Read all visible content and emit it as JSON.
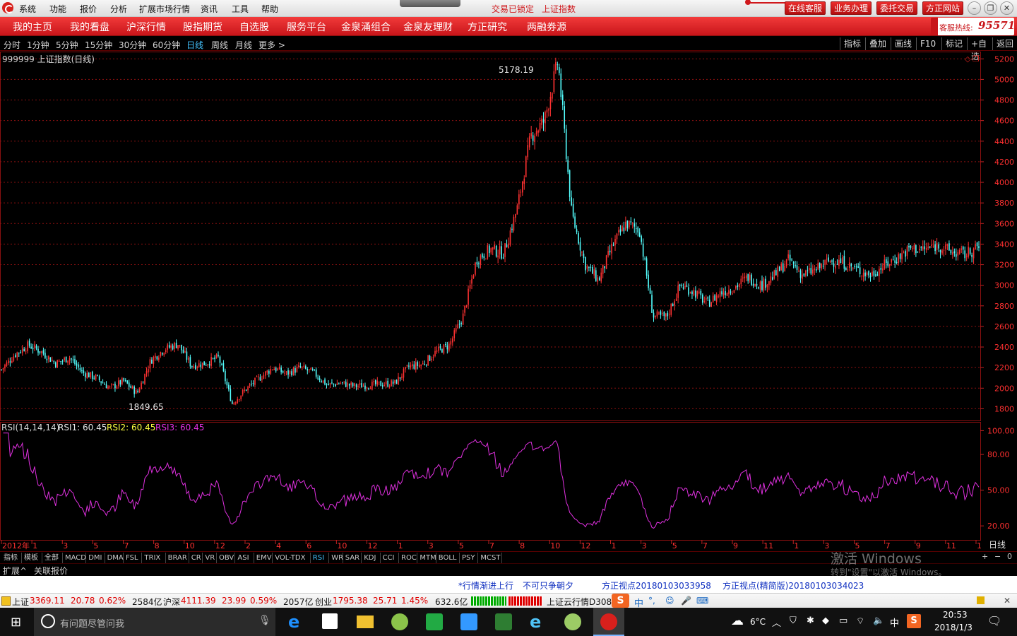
{
  "titlebar": {
    "menus": [
      "系统",
      "功能",
      "报价",
      "分析",
      "扩展市场行情",
      "资讯",
      "工具",
      "帮助"
    ],
    "lock_status": "交易已锁定",
    "lock_index": "上证指数",
    "buttons": [
      "在线客服",
      "业务办理",
      "委托交易",
      "方正网站"
    ]
  },
  "nav": {
    "items": [
      "我的主页",
      "我的看盘",
      "沪深行情",
      "股指期货",
      "自选股",
      "服务平台",
      "金泉涌组合",
      "金泉友理财",
      "方正研究",
      "两融券源"
    ],
    "hotline_label": "客服热线:",
    "hotline_number": "95571"
  },
  "periods": {
    "items": [
      "分时",
      "1分钟",
      "5分钟",
      "15分钟",
      "30分钟",
      "60分钟",
      "日线",
      "周线",
      "月线",
      "更多 >"
    ],
    "selected": "日线",
    "right_buttons": [
      "指标",
      "叠加",
      "画线",
      "F10",
      "标记",
      "+自选",
      "返回"
    ]
  },
  "chart_data": {
    "type": "candlestick",
    "title": "999999 上证指数(日线)",
    "price_ticks": [
      "5200",
      "5000",
      "4800",
      "4600",
      "4400",
      "4200",
      "4000",
      "3800",
      "3600",
      "3400",
      "3200",
      "3000",
      "2800",
      "2600",
      "2400",
      "2200",
      "2000",
      "1800"
    ],
    "price_range": [
      1700,
      5250
    ],
    "annotations": {
      "high_label": "5178.19",
      "low_label": "1849.65"
    },
    "colors": {
      "up": "#ff3232",
      "down": "#54ffff",
      "grid": "#8a1010",
      "rsi": "#e030e0"
    },
    "close_path": [
      {
        "x": "2012-01",
        "y": 2180
      },
      {
        "x": "2012-02",
        "y": 2330
      },
      {
        "x": "2012-03",
        "y": 2420
      },
      {
        "x": "2012-04",
        "y": 2350
      },
      {
        "x": "2012-05",
        "y": 2240
      },
      {
        "x": "2012-06",
        "y": 2300
      },
      {
        "x": "2012-07",
        "y": 2150
      },
      {
        "x": "2012-08",
        "y": 2100
      },
      {
        "x": "2012-09",
        "y": 2000
      },
      {
        "x": "2012-10",
        "y": 2070
      },
      {
        "x": "2012-11",
        "y": 1950
      },
      {
        "x": "2012-12",
        "y": 2270
      },
      {
        "x": "2013-01",
        "y": 2380
      },
      {
        "x": "2013-02",
        "y": 2430
      },
      {
        "x": "2013-03",
        "y": 2220
      },
      {
        "x": "2013-04",
        "y": 2240
      },
      {
        "x": "2013-05",
        "y": 2300
      },
      {
        "x": "2013-06",
        "y": 1849.65
      },
      {
        "x": "2013-07",
        "y": 1990
      },
      {
        "x": "2013-08",
        "y": 2100
      },
      {
        "x": "2013-09",
        "y": 2200
      },
      {
        "x": "2013-10",
        "y": 2140
      },
      {
        "x": "2013-11",
        "y": 2200
      },
      {
        "x": "2013-12",
        "y": 2150
      },
      {
        "x": "2014-01",
        "y": 2030
      },
      {
        "x": "2014-02",
        "y": 2050
      },
      {
        "x": "2014-03",
        "y": 2020
      },
      {
        "x": "2014-04",
        "y": 2030
      },
      {
        "x": "2014-05",
        "y": 2040
      },
      {
        "x": "2014-06",
        "y": 2050
      },
      {
        "x": "2014-07",
        "y": 2210
      },
      {
        "x": "2014-08",
        "y": 2230
      },
      {
        "x": "2014-09",
        "y": 2350
      },
      {
        "x": "2014-10",
        "y": 2420
      },
      {
        "x": "2014-11",
        "y": 2700
      },
      {
        "x": "2014-12",
        "y": 3250
      },
      {
        "x": "2015-01",
        "y": 3350
      },
      {
        "x": "2015-02",
        "y": 3310
      },
      {
        "x": "2015-03",
        "y": 3750
      },
      {
        "x": "2015-04",
        "y": 4450
      },
      {
        "x": "2015-05",
        "y": 4600
      },
      {
        "x": "2015-06",
        "y": 5178.19
      },
      {
        "x": "2015-07",
        "y": 3700
      },
      {
        "x": "2015-08",
        "y": 3200
      },
      {
        "x": "2015-09",
        "y": 3050
      },
      {
        "x": "2015-10",
        "y": 3380
      },
      {
        "x": "2015-11",
        "y": 3600
      },
      {
        "x": "2015-12",
        "y": 3540
      },
      {
        "x": "2016-01",
        "y": 2700
      },
      {
        "x": "2016-02",
        "y": 2690
      },
      {
        "x": "2016-03",
        "y": 3000
      },
      {
        "x": "2016-04",
        "y": 2940
      },
      {
        "x": "2016-05",
        "y": 2820
      },
      {
        "x": "2016-06",
        "y": 2930
      },
      {
        "x": "2016-07",
        "y": 2980
      },
      {
        "x": "2016-08",
        "y": 3080
      },
      {
        "x": "2016-09",
        "y": 3000
      },
      {
        "x": "2016-10",
        "y": 3100
      },
      {
        "x": "2016-11",
        "y": 3250
      },
      {
        "x": "2016-12",
        "y": 3100
      },
      {
        "x": "2017-01",
        "y": 3150
      },
      {
        "x": "2017-02",
        "y": 3240
      },
      {
        "x": "2017-03",
        "y": 3220
      },
      {
        "x": "2017-04",
        "y": 3150
      },
      {
        "x": "2017-05",
        "y": 3100
      },
      {
        "x": "2017-06",
        "y": 3190
      },
      {
        "x": "2017-07",
        "y": 3270
      },
      {
        "x": "2017-08",
        "y": 3360
      },
      {
        "x": "2017-09",
        "y": 3350
      },
      {
        "x": "2017-10",
        "y": 3390
      },
      {
        "x": "2017-11",
        "y": 3320
      },
      {
        "x": "2017-12",
        "y": 3300
      },
      {
        "x": "2018-01",
        "y": 3369.11
      }
    ],
    "rsi": {
      "header": "RSI(14,14,14)",
      "series": [
        {
          "name": "RSI1",
          "value": "60.45",
          "color": "#e8e8e8"
        },
        {
          "name": "RSI2",
          "value": "60.45",
          "color": "#ffff40"
        },
        {
          "name": "RSI3",
          "value": "60.45",
          "color": "#e030e0"
        }
      ],
      "ticks": [
        "100.00",
        "80.00",
        "50.00",
        "20.00"
      ],
      "range": [
        10,
        105
      ]
    },
    "time_axis": [
      "2012年",
      "1",
      "3",
      "5",
      "7",
      "8",
      "10",
      "12",
      "2",
      "4",
      "6",
      "10",
      "12",
      "1",
      "3",
      "5",
      "7",
      "8",
      "10",
      "12",
      "1",
      "3",
      "5",
      "7",
      "9",
      "11",
      "1",
      "3",
      "5",
      "7",
      "9",
      "11",
      "1"
    ],
    "time_axis_right": "日线"
  },
  "indicator_tabs": {
    "items": [
      "指标",
      "模板",
      "全部",
      "MACD",
      "DMI",
      "DMA",
      "FSL",
      "TRIX",
      "BRAR",
      "CR",
      "VR",
      "OBV",
      "ASI",
      "EMV",
      "VOL-TDX",
      "RSI",
      "WR",
      "SAR",
      "KDJ",
      "CCI",
      "ROC",
      "MTM",
      "BOLL",
      "PSY",
      "MCST"
    ],
    "selected": "RSI"
  },
  "ext_bar": {
    "items": [
      "扩展^",
      "关联报价"
    ]
  },
  "news": {
    "items": [
      "*行情渐进上行",
      "不可只争朝夕",
      "方正视点20180103033958",
      "方正视点(精简版)20180103034023"
    ]
  },
  "status": {
    "sh_label": "上证",
    "sh_value": "3369.11",
    "sh_change": "20.78",
    "sh_pct": "0.62%",
    "sh_amount": "2584亿",
    "hs_label": "沪深",
    "hs_value": "4111.39",
    "hs_change": "23.99",
    "hs_pct": "0.59%",
    "hs_amount": "2057亿",
    "cy_label": "创业",
    "cy_value": "1795.38",
    "cy_change": "25.71",
    "cy_pct": "1.45%",
    "cy_amount": "632.6亿",
    "server": "上证云行情D308",
    "ime_items": [
      "中",
      "°,",
      "☺",
      "🎤",
      "⌨"
    ]
  },
  "watermark": {
    "line1": "激活 Windows",
    "line2": "转到\"设置\"以激活 Windows。"
  },
  "taskbar": {
    "search_placeholder": "有问题尽管问我",
    "weather": "6°C",
    "ime": "中",
    "time": "20:53",
    "date": "2018/1/3"
  }
}
